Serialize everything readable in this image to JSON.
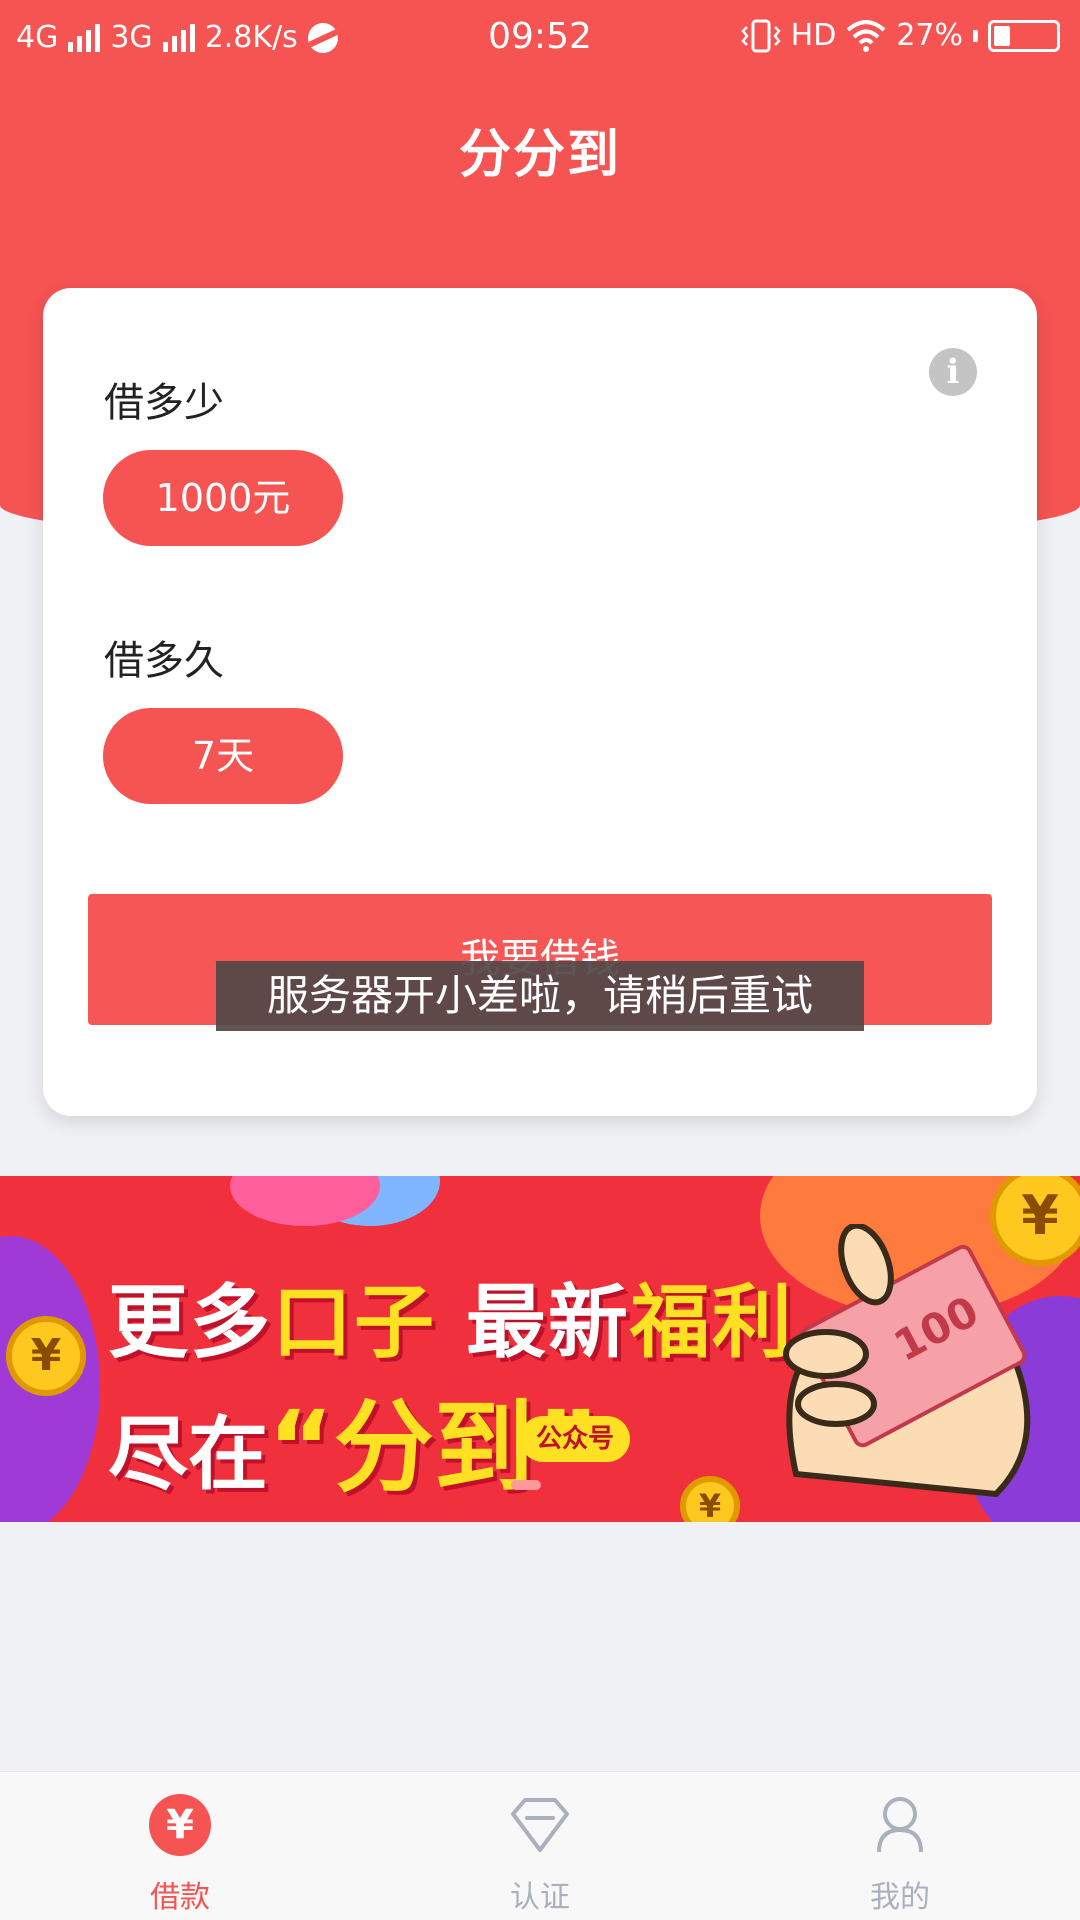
{
  "status_bar": {
    "network1": "4G",
    "network2": "3G",
    "speed": "2.8K/s",
    "time": "09:52",
    "hd": "HD",
    "battery": "27%"
  },
  "header": {
    "title": "分分到"
  },
  "loan_card": {
    "amount_label": "借多少",
    "amount_value": "1000元",
    "duration_label": "借多久",
    "duration_value": "7天",
    "submit_label": "我要借钱"
  },
  "toast": {
    "message": "服务器开小差啦，请稍后重试"
  },
  "banner": {
    "line1_a": "更多",
    "line1_b": "口子",
    "line1_c": "最新",
    "line1_d": "福利",
    "line2_a": "尽在",
    "line2_b": "“分到”",
    "badge": "公众号",
    "coin_symbol": "¥",
    "note_value": "100"
  },
  "bottom_nav": {
    "items": [
      {
        "label": "借款",
        "icon": "yen-icon",
        "active": true
      },
      {
        "label": "认证",
        "icon": "diamond-icon",
        "active": false
      },
      {
        "label": "我的",
        "icon": "person-icon",
        "active": false
      }
    ]
  },
  "colors": {
    "brand_red": "#f65353",
    "page_bg": "#f0f1f5",
    "inactive_nav": "#aab0bd"
  }
}
